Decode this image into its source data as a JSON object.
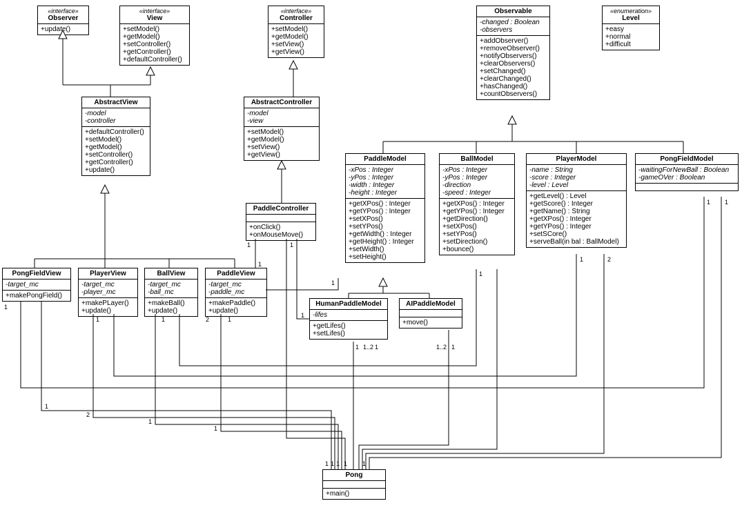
{
  "observer": {
    "stereo": "«interface»",
    "name": "Observer",
    "m": [
      "+update()"
    ]
  },
  "view": {
    "stereo": "«interface»",
    "name": "View",
    "m": [
      "+setModel()",
      "+getModel()",
      "+setController()",
      "+getController()",
      "+defaultController()"
    ]
  },
  "controller": {
    "stereo": "«interface»",
    "name": "Controller",
    "m": [
      "+setModel()",
      "+getModel()",
      "+setView()",
      "+getView()"
    ]
  },
  "observable": {
    "name": "Observable",
    "a": [
      "-changed : Boolean",
      "-observers"
    ],
    "m": [
      "+addObserver()",
      "+removeObserver()",
      "+notifyObservers()",
      "+clearObservers()",
      "+setChanged()",
      "+clearChanged()",
      "+hasChanged()",
      "+countObservers()"
    ]
  },
  "level": {
    "stereo": "«enumeration»",
    "name": "Level",
    "v": [
      "+easy",
      "+normal",
      "+difficult"
    ]
  },
  "abstractview": {
    "name": "AbstractView",
    "a": [
      "-model",
      "-controller"
    ],
    "m": [
      "+defaultController()",
      "+setModel()",
      "+getModel()",
      "+setController()",
      "+getController()",
      "+update()"
    ]
  },
  "abstractcontroller": {
    "name": "AbstractController",
    "a": [
      "-model",
      "-view"
    ],
    "m": [
      "+setModel()",
      "+getModel()",
      "+setView()",
      "+getView()"
    ]
  },
  "paddlecontroller": {
    "name": "PaddleController",
    "m": [
      "+onClick()",
      "+onMouseMove()"
    ]
  },
  "paddlemodel": {
    "name": "PaddleModel",
    "a": [
      "-xPos : Integer",
      "-yPos : Integer",
      "-width : Integer",
      "-height : Integer"
    ],
    "m": [
      "+getXPos() : Integer",
      "+getYPos() : Integer",
      "+setXPos()",
      "+setYPos()",
      "+getWidth() : Integer",
      "+getHeight() : Integer",
      "+setWidth()",
      "+setHeight()"
    ]
  },
  "ballmodel": {
    "name": "BallModel",
    "a": [
      "-xPos : Integer",
      "-yPos : Integer",
      "-direction",
      "-speed : Integer"
    ],
    "m": [
      "+getXPos() : Integer",
      "+getYPos() : Integer",
      "+getDirection()",
      "+setXPos()",
      "+setYPos()",
      "+setDirection()",
      "+bounce()"
    ]
  },
  "playermodel": {
    "name": "PlayerModel",
    "a": [
      "-name : String",
      "-score : Integer",
      "-level : Level"
    ],
    "m": [
      "+getLevel() : Level",
      "+getScore() : Integer",
      "+getName() : String",
      "+getXPos() : Integer",
      "+getYPos() : Integer",
      "+setSCore()",
      "+serveBall(in bal : BallModel)"
    ]
  },
  "pongfieldmodel": {
    "name": "PongFieldModel",
    "a": [
      "-waitingForNewBall : Boolean",
      "-gameOVer : Boolean"
    ]
  },
  "pongfieldview": {
    "name": "PongFieldView",
    "a": [
      "-target_mc"
    ],
    "m": [
      "+makePongField()"
    ]
  },
  "playerview": {
    "name": "PlayerView",
    "a": [
      "-target_mc",
      "-player_mc"
    ],
    "m": [
      "+makePLayer()",
      "+update()"
    ]
  },
  "ballview": {
    "name": "BallView",
    "a": [
      "-target_mc",
      "-ball_mc"
    ],
    "m": [
      "+makeBall()",
      "+update()"
    ]
  },
  "paddleview": {
    "name": "PaddleView",
    "a": [
      "-target_mc",
      "-paddle_mc"
    ],
    "m": [
      "+makePaddle()",
      "+update()"
    ]
  },
  "humanpaddle": {
    "name": "HumanPaddleModel",
    "a": [
      "-lifes"
    ],
    "m": [
      "+getLifes()",
      "+setLifes()"
    ]
  },
  "aipaddle": {
    "name": "AIPaddleModel",
    "m": [
      "+move()"
    ]
  },
  "pong": {
    "name": "Pong",
    "m": [
      "+main()"
    ]
  },
  "mults": {
    "m1": "1",
    "m2": "2",
    "m12": "1..2"
  }
}
